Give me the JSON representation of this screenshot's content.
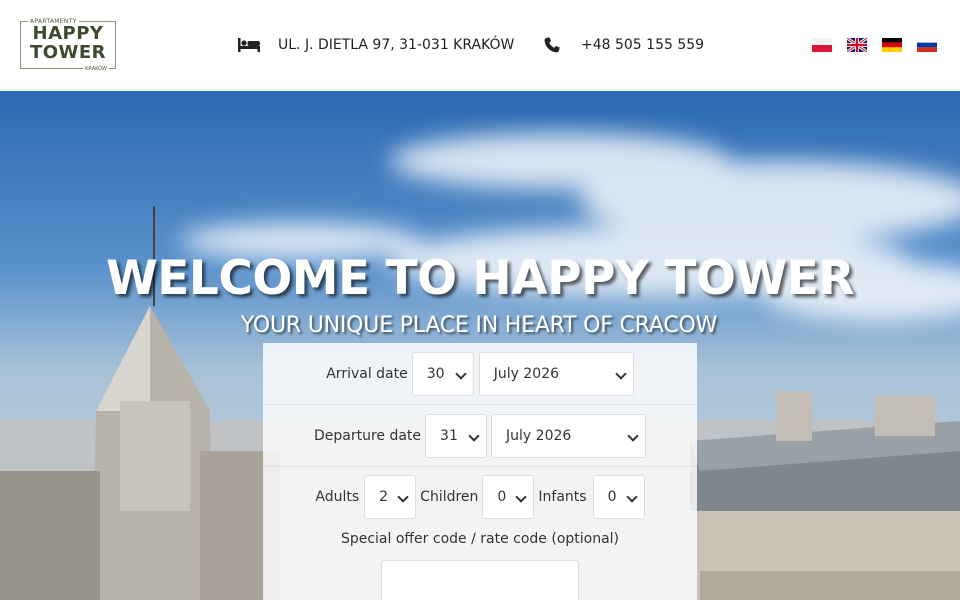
{
  "header": {
    "logo": {
      "top_text": "APARTAMENTY",
      "line1": "HAPPY",
      "line2": "TOWER",
      "bottom_text": "KRAKÓW"
    },
    "address": "UL. J. DIETLA 97, 31-031 KRAKÓW",
    "phone": "+48 505 155 559",
    "languages": [
      "pl",
      "en",
      "de",
      "ru"
    ]
  },
  "hero": {
    "title": "WELCOME TO HAPPY TOWER",
    "subtitle": "YOUR UNIQUE PLACE IN HEART OF CRACOW"
  },
  "booking": {
    "arrival_label": "Arrival date",
    "arrival_day": "30",
    "arrival_month": "July 2026",
    "departure_label": "Departure date",
    "departure_day": "31",
    "departure_month": "July 2026",
    "adults_label": "Adults",
    "adults_value": "2",
    "children_label": "Children",
    "children_value": "0",
    "infants_label": "Infants",
    "infants_value": "0",
    "code_label": "Special offer code / rate code (optional)",
    "code_value": ""
  },
  "colors": {
    "logo_green": "#3c4a2e",
    "text": "#222222"
  }
}
